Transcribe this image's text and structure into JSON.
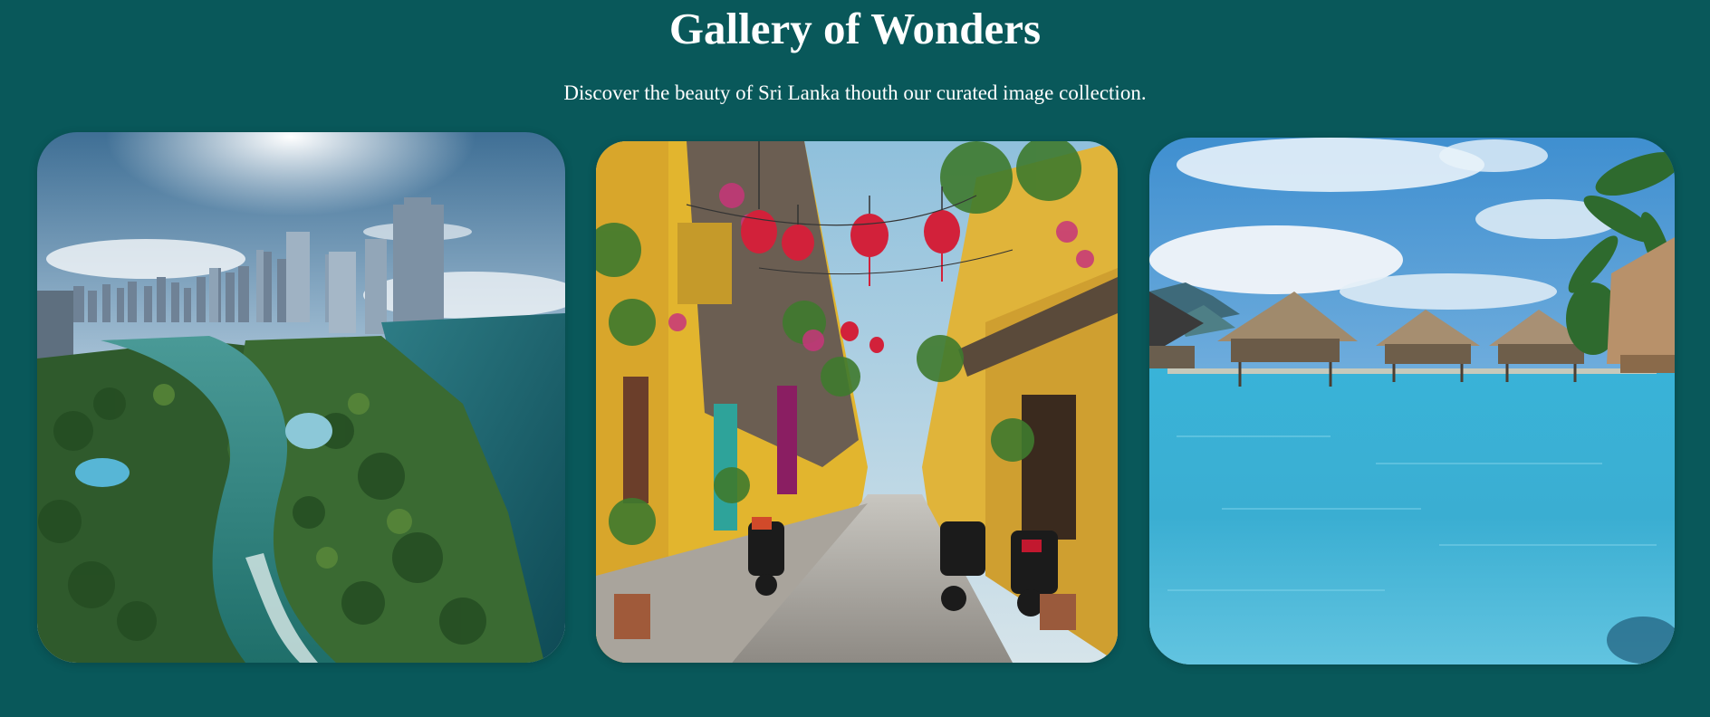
{
  "page": {
    "title": "Gallery of Wonders",
    "subtitle": "Discover the beauty of Sri Lanka thouth our curated image collection."
  },
  "gallery": {
    "images": [
      {
        "depicts": "city-coast-aerial"
      },
      {
        "depicts": "lantern-street"
      },
      {
        "depicts": "overwater-bungalows"
      }
    ]
  },
  "colors": {
    "background": "#09585a",
    "text": "#ffffff"
  }
}
